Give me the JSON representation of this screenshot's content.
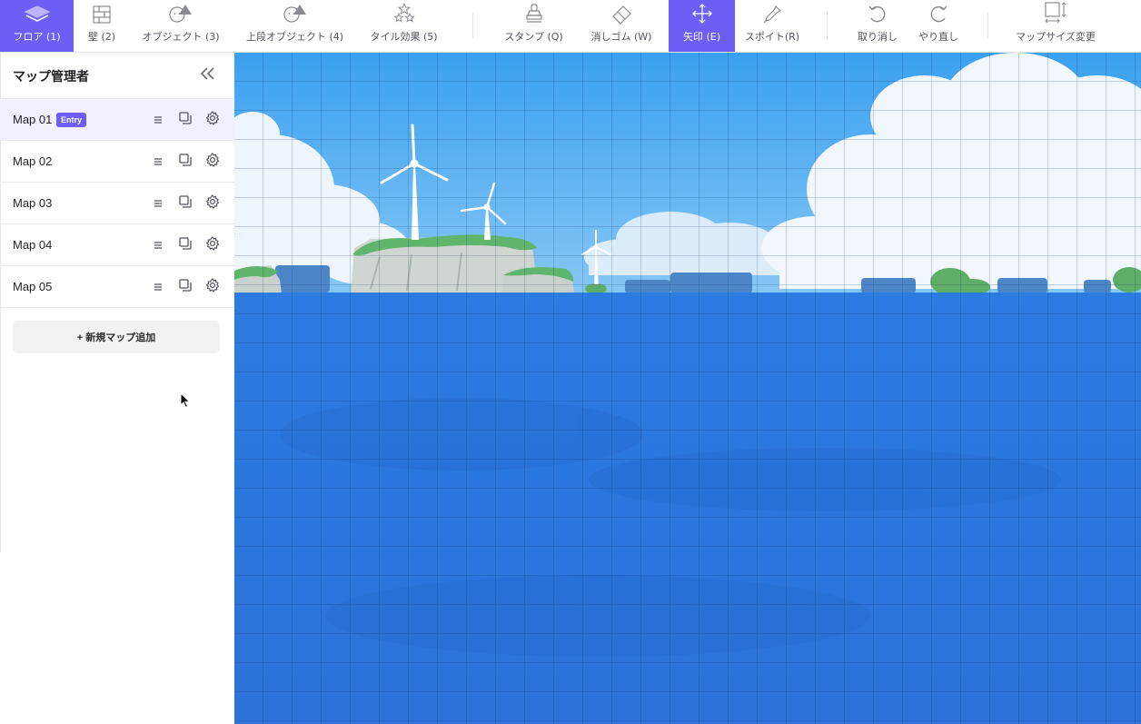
{
  "toolbar": {
    "tools": [
      {
        "label": "フロア (1)",
        "icon": "layers-icon",
        "active": true
      },
      {
        "label": "壁 (2)",
        "icon": "brick-wall-icon",
        "active": false
      },
      {
        "label": "オブジェクト (3)",
        "icon": "object-icon",
        "active": false
      },
      {
        "label": "上段オブジェクト (4)",
        "icon": "upper-object-icon",
        "active": false
      },
      {
        "label": "タイル効果 (5)",
        "icon": "sparkle-stars-icon",
        "active": false
      },
      {
        "label": "スタンプ (Q)",
        "icon": "stamp-icon",
        "active": false
      },
      {
        "label": "消しゴム (W)",
        "icon": "eraser-icon",
        "active": false
      },
      {
        "label": "矢印 (E)",
        "icon": "move-arrows-icon",
        "active": true
      },
      {
        "label": "スポイト(R)",
        "icon": "eyedropper-icon",
        "active": false
      },
      {
        "label": "取り消し",
        "icon": "undo-icon",
        "active": false
      },
      {
        "label": "やり直し",
        "icon": "redo-icon",
        "active": false
      },
      {
        "label": "マップサイズ変更",
        "icon": "resize-map-icon",
        "active": false
      }
    ]
  },
  "sidebar": {
    "title": "マップ管理者",
    "maps": [
      {
        "name": "Map 01",
        "badge": "Entry",
        "selected": true
      },
      {
        "name": "Map 02",
        "badge": "",
        "selected": false
      },
      {
        "name": "Map 03",
        "badge": "",
        "selected": false
      },
      {
        "name": "Map 04",
        "badge": "",
        "selected": false
      },
      {
        "name": "Map 05",
        "badge": "",
        "selected": false
      }
    ],
    "add_map_label": "+ 新規マップ追加"
  },
  "colors": {
    "accent": "#6d5ef5",
    "selected_row": "#f2f0ff",
    "sky": "#4aa8f0",
    "sea": "#2b78e0",
    "grid_line": "#1e3c6e"
  }
}
